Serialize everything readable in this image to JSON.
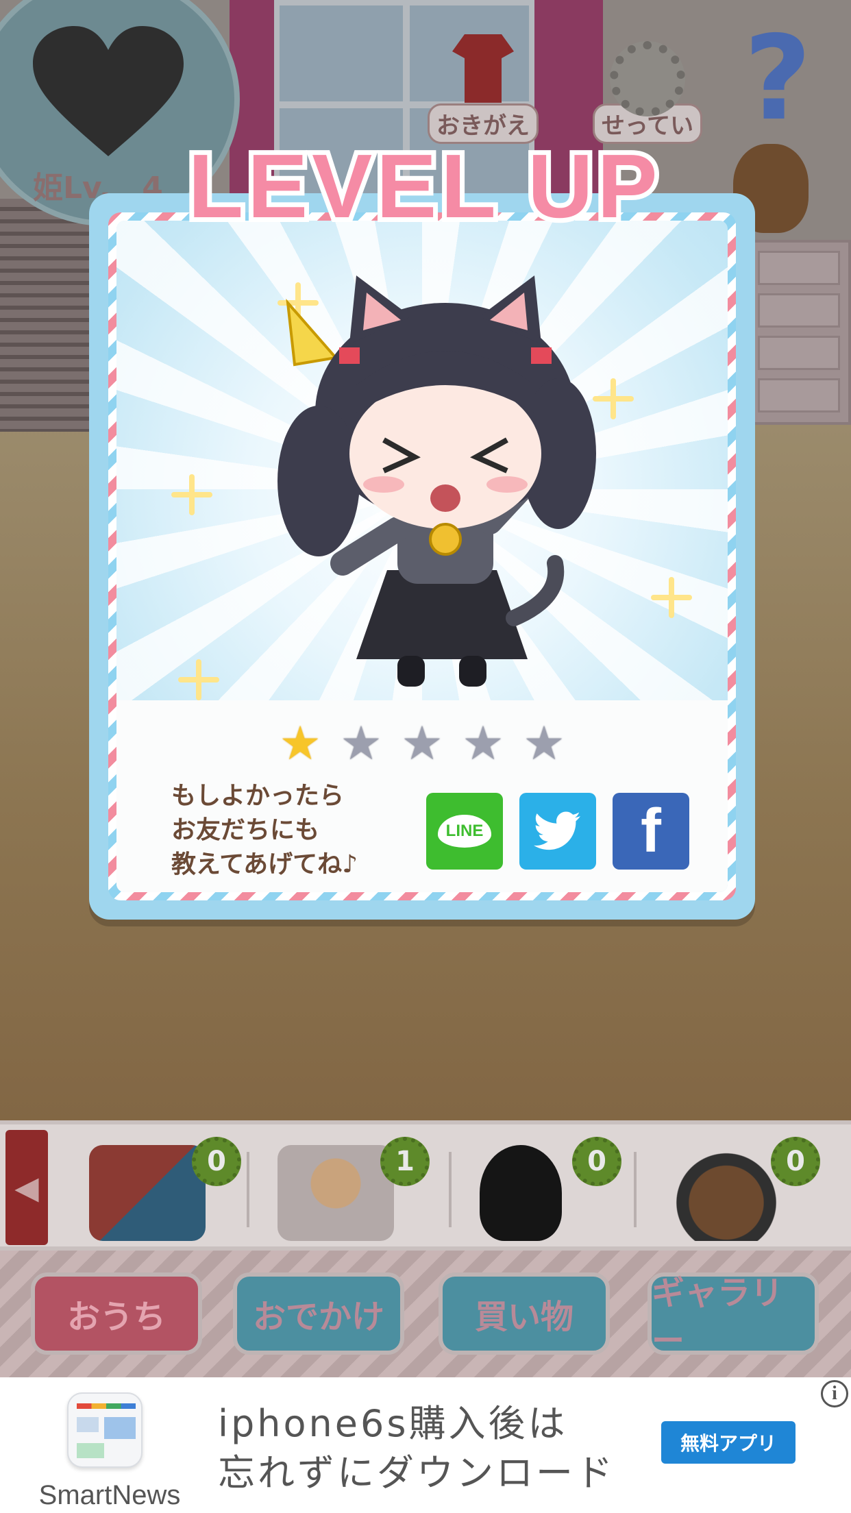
{
  "hud": {
    "heart_level_label": "姫Lv.",
    "heart_level_value": "4",
    "dressup_label": "おきがえ",
    "settings_label": "せってい",
    "help_icon": "?"
  },
  "modal": {
    "title": "LEVEL UP",
    "rating": {
      "filled": 1,
      "total": 5
    },
    "stars": [
      "★",
      "★",
      "★",
      "★",
      "★"
    ],
    "share_message": [
      "もしよかったら",
      "お友だちにも",
      "教えてあげてね♪"
    ],
    "share_buttons": {
      "line": "LINE",
      "twitter": "🐦",
      "facebook": "f"
    }
  },
  "items": [
    {
      "name": "game",
      "count": "0"
    },
    {
      "name": "parfait",
      "count": "1"
    },
    {
      "name": "shadow",
      "count": "0"
    },
    {
      "name": "sukiyaki",
      "count": "0"
    }
  ],
  "item_bar": {
    "arrow": "◀"
  },
  "nav": {
    "home": "おうち",
    "outing": "おでかけ",
    "shopping": "買い物",
    "gallery": "ギャラリー"
  },
  "ad": {
    "brand": "SmartNews",
    "line1": "iphone6s購入後は",
    "line2": "忘れずにダウンロード",
    "cta": "無料アプリ",
    "info": "i"
  },
  "colors": {
    "modal_frame": "#9fd6ee",
    "star_on": "#f7c52a",
    "star_off": "#9c9fae",
    "title_pink": "#f58ba5",
    "line_green": "#3ebd2f",
    "twitter_blue": "#2bb0e8",
    "facebook_blue": "#3a67b8",
    "ad_cta": "#1f86d6"
  }
}
